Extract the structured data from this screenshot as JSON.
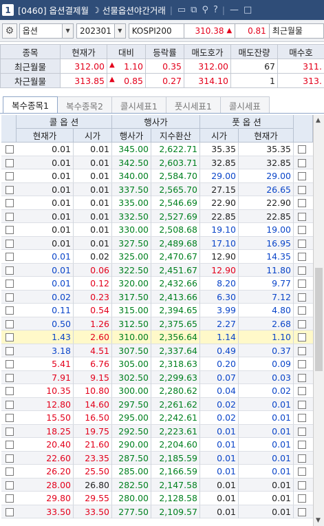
{
  "window": {
    "num": "1",
    "title": "[0460] 옵션결제월",
    "subtitle": "선물옵션야간거래",
    "icons": [
      "restore-icon",
      "copy-icon",
      "pin-icon",
      "help-icon",
      "minimize-icon",
      "maximize-icon"
    ],
    "icon_glyphs": [
      "▭",
      "⧉",
      "⚲",
      "?",
      "—",
      "□"
    ]
  },
  "toolbar": {
    "market": "옵션",
    "month": "202301",
    "index_name": "KOSPI200",
    "index_value": "310.38",
    "index_arrow": "▲",
    "index_change": "0.81",
    "trailing": "최근월물"
  },
  "summary": {
    "headers": [
      "종목",
      "현재가",
      "대비",
      "등락률",
      "매도호가",
      "매도잔량",
      "매수호"
    ],
    "rows": [
      {
        "name": "최근월물",
        "price": "312.00",
        "arrow": "▲",
        "change": "1.10",
        "rate": "0.35",
        "ask": "312.00",
        "ask_qty": "67",
        "bid": "311."
      },
      {
        "name": "차근월물",
        "price": "313.85",
        "arrow": "▲",
        "change": "0.85",
        "rate": "0.27",
        "ask": "314.10",
        "ask_qty": "1",
        "bid": "313."
      }
    ]
  },
  "tabs": [
    "복수종목1",
    "복수종목2",
    "콜시세표1",
    "풋시세표1",
    "콜시세표"
  ],
  "grid": {
    "call_header": "콜  옵  션",
    "strike_header": "행사가",
    "put_header": "풋  옵  션",
    "sub": [
      "현재가",
      "시가",
      "행사가",
      "지수환산",
      "시가",
      "현재가"
    ],
    "rows": [
      {
        "cc": "0.01",
        "co": "0.01",
        "k": "345.00",
        "idx": "2,622.71",
        "po": "35.35",
        "pc": "35.35",
        "cls": [
          "k",
          "k",
          "k",
          "k"
        ]
      },
      {
        "cc": "0.01",
        "co": "0.01",
        "k": "342.50",
        "idx": "2,603.71",
        "po": "32.85",
        "pc": "32.85",
        "cls": [
          "k",
          "k",
          "k",
          "k"
        ]
      },
      {
        "cc": "0.01",
        "co": "0.01",
        "k": "340.00",
        "idx": "2,584.70",
        "po": "29.00",
        "pc": "29.00",
        "cls": [
          "k",
          "k",
          "b",
          "b"
        ]
      },
      {
        "cc": "0.01",
        "co": "0.01",
        "k": "337.50",
        "idx": "2,565.70",
        "po": "27.15",
        "pc": "26.65",
        "cls": [
          "k",
          "k",
          "k",
          "b"
        ]
      },
      {
        "cc": "0.01",
        "co": "0.01",
        "k": "335.00",
        "idx": "2,546.69",
        "po": "22.90",
        "pc": "22.90",
        "cls": [
          "k",
          "k",
          "k",
          "k"
        ]
      },
      {
        "cc": "0.01",
        "co": "0.01",
        "k": "332.50",
        "idx": "2,527.69",
        "po": "22.85",
        "pc": "22.85",
        "cls": [
          "k",
          "k",
          "k",
          "k"
        ]
      },
      {
        "cc": "0.01",
        "co": "0.01",
        "k": "330.00",
        "idx": "2,508.68",
        "po": "19.10",
        "pc": "19.00",
        "cls": [
          "k",
          "k",
          "b",
          "b"
        ]
      },
      {
        "cc": "0.01",
        "co": "0.01",
        "k": "327.50",
        "idx": "2,489.68",
        "po": "17.10",
        "pc": "16.95",
        "cls": [
          "k",
          "k",
          "b",
          "b"
        ]
      },
      {
        "cc": "0.01",
        "co": "0.02",
        "k": "325.00",
        "idx": "2,470.67",
        "po": "12.90",
        "pc": "14.35",
        "cls": [
          "b",
          "k",
          "k",
          "b"
        ]
      },
      {
        "cc": "0.01",
        "co": "0.06",
        "k": "322.50",
        "idx": "2,451.67",
        "po": "12.90",
        "pc": "11.80",
        "cls": [
          "b",
          "r",
          "r",
          "b"
        ]
      },
      {
        "cc": "0.01",
        "co": "0.12",
        "k": "320.00",
        "idx": "2,432.66",
        "po": "8.20",
        "pc": "9.77",
        "cls": [
          "b",
          "r",
          "b",
          "b"
        ]
      },
      {
        "cc": "0.02",
        "co": "0.23",
        "k": "317.50",
        "idx": "2,413.66",
        "po": "6.30",
        "pc": "7.12",
        "cls": [
          "b",
          "r",
          "b",
          "b"
        ]
      },
      {
        "cc": "0.11",
        "co": "0.54",
        "k": "315.00",
        "idx": "2,394.65",
        "po": "3.99",
        "pc": "4.80",
        "cls": [
          "b",
          "r",
          "b",
          "b"
        ]
      },
      {
        "cc": "0.50",
        "co": "1.26",
        "k": "312.50",
        "idx": "2,375.65",
        "po": "2.27",
        "pc": "2.68",
        "cls": [
          "b",
          "r",
          "b",
          "b"
        ]
      },
      {
        "cc": "1.43",
        "co": "2.60",
        "k": "310.00",
        "idx": "2,356.64",
        "po": "1.14",
        "pc": "1.10",
        "cls": [
          "b",
          "r",
          "b",
          "b"
        ]
      },
      {
        "cc": "3.18",
        "co": "4.51",
        "k": "307.50",
        "idx": "2,337.64",
        "po": "0.49",
        "pc": "0.37",
        "cls": [
          "b",
          "r",
          "b",
          "b"
        ]
      },
      {
        "cc": "5.41",
        "co": "6.76",
        "k": "305.00",
        "idx": "2,318.63",
        "po": "0.20",
        "pc": "0.09",
        "cls": [
          "r",
          "r",
          "b",
          "b"
        ]
      },
      {
        "cc": "7.91",
        "co": "9.15",
        "k": "302.50",
        "idx": "2,299.63",
        "po": "0.07",
        "pc": "0.03",
        "cls": [
          "r",
          "r",
          "b",
          "b"
        ]
      },
      {
        "cc": "10.35",
        "co": "10.80",
        "k": "300.00",
        "idx": "2,280.62",
        "po": "0.04",
        "pc": "0.02",
        "cls": [
          "r",
          "r",
          "b",
          "b"
        ]
      },
      {
        "cc": "12.80",
        "co": "14.60",
        "k": "297.50",
        "idx": "2,261.62",
        "po": "0.02",
        "pc": "0.01",
        "cls": [
          "r",
          "r",
          "b",
          "b"
        ]
      },
      {
        "cc": "15.50",
        "co": "16.50",
        "k": "295.00",
        "idx": "2,242.61",
        "po": "0.02",
        "pc": "0.01",
        "cls": [
          "r",
          "r",
          "b",
          "b"
        ]
      },
      {
        "cc": "18.25",
        "co": "19.75",
        "k": "292.50",
        "idx": "2,223.61",
        "po": "0.01",
        "pc": "0.01",
        "cls": [
          "r",
          "r",
          "b",
          "b"
        ]
      },
      {
        "cc": "20.40",
        "co": "21.60",
        "k": "290.00",
        "idx": "2,204.60",
        "po": "0.01",
        "pc": "0.01",
        "cls": [
          "r",
          "r",
          "b",
          "b"
        ]
      },
      {
        "cc": "22.60",
        "co": "23.35",
        "k": "287.50",
        "idx": "2,185.59",
        "po": "0.01",
        "pc": "0.01",
        "cls": [
          "r",
          "r",
          "b",
          "b"
        ]
      },
      {
        "cc": "26.20",
        "co": "25.50",
        "k": "285.00",
        "idx": "2,166.59",
        "po": "0.01",
        "pc": "0.01",
        "cls": [
          "r",
          "r",
          "b",
          "b"
        ]
      },
      {
        "cc": "28.00",
        "co": "26.80",
        "k": "282.50",
        "idx": "2,147.58",
        "po": "0.01",
        "pc": "0.01",
        "cls": [
          "r",
          "k",
          "k",
          "k"
        ]
      },
      {
        "cc": "29.80",
        "co": "29.55",
        "k": "280.00",
        "idx": "2,128.58",
        "po": "0.01",
        "pc": "0.01",
        "cls": [
          "r",
          "r",
          "k",
          "k"
        ]
      },
      {
        "cc": "33.50",
        "co": "33.50",
        "k": "277.50",
        "idx": "2,109.57",
        "po": "0.01",
        "pc": "0.01",
        "cls": [
          "r",
          "r",
          "k",
          "k"
        ]
      }
    ]
  }
}
